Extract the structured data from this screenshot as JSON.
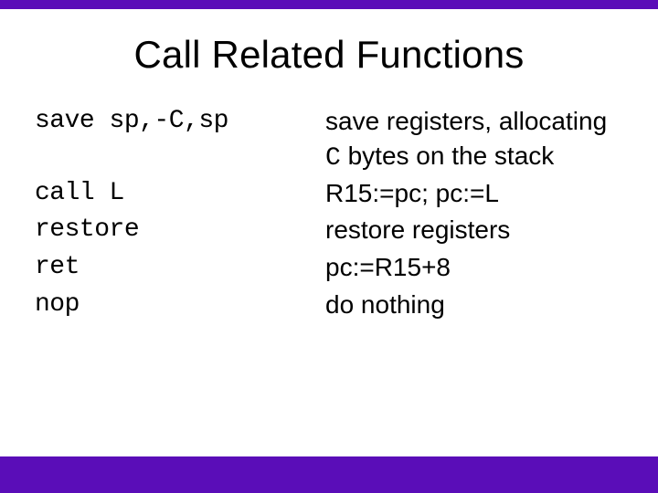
{
  "title": "Call Related Functions",
  "rows": [
    {
      "instr": "save sp,-C,sp",
      "desc_pre": "save registers, allocating ",
      "desc_code": "C",
      "desc_post": " bytes on the stack"
    },
    {
      "instr": "call L",
      "desc_pre": "R15:=pc; pc:=L",
      "desc_code": "",
      "desc_post": ""
    },
    {
      "instr": "restore",
      "desc_pre": "restore registers",
      "desc_code": "",
      "desc_post": ""
    },
    {
      "instr": "ret",
      "desc_pre": "pc:=R15+8",
      "desc_code": "",
      "desc_post": ""
    },
    {
      "instr": "nop",
      "desc_pre": "do nothing",
      "desc_code": "",
      "desc_post": ""
    }
  ]
}
